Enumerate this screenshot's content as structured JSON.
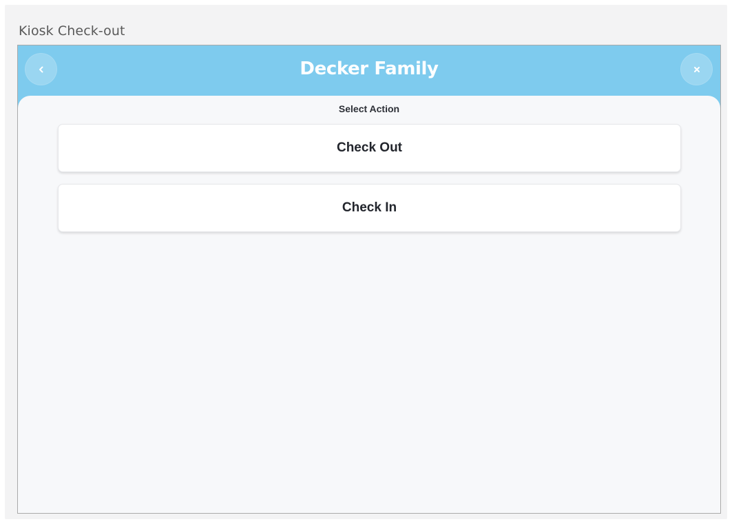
{
  "page": {
    "caption": "Kiosk Check-out"
  },
  "header": {
    "title": "Decker Family",
    "back_icon": "chevron-left-icon",
    "close_icon": "close-icon",
    "background_color": "#7ecbee"
  },
  "main": {
    "section_label": "Select Action",
    "actions": [
      {
        "label": "Check Out"
      },
      {
        "label": "Check In"
      }
    ]
  }
}
